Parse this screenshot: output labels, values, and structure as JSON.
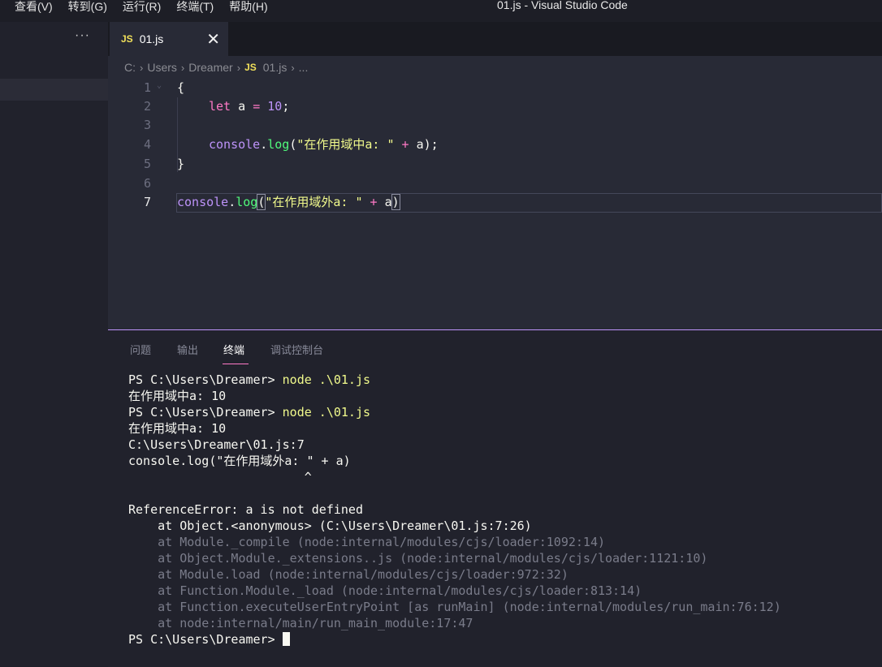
{
  "menu": [
    "查看(V)",
    "转到(G)",
    "运行(R)",
    "终端(T)",
    "帮助(H)"
  ],
  "window_title": "01.js - Visual Studio Code",
  "sidebar": {
    "more_label": "···"
  },
  "tab": {
    "badge": "JS",
    "label": "01.js",
    "close": "✕"
  },
  "breadcrumb": {
    "items": [
      "C:",
      "Users",
      "Dreamer"
    ],
    "file_badge": "JS",
    "file": "01.js",
    "tail": "...",
    "separator": "›"
  },
  "editor": {
    "line_numbers": [
      "1",
      "2",
      "3",
      "4",
      "5",
      "6",
      "7"
    ],
    "active_line": "7",
    "code": {
      "l1": "{",
      "l2_kw": "let",
      "l2_var": " a ",
      "l2_op": "=",
      "l2_num": "10",
      "l2_end": ";",
      "l4_obj": "console",
      "l4_dot": ".",
      "l4_fn": "log",
      "l4_open": "(",
      "l4_str": "\"在作用域中a: \"",
      "l4_op": " + ",
      "l4_rest": "a);",
      "l5": "}",
      "l7_obj": "console",
      "l7_dot": ".",
      "l7_fn": "log",
      "l7_open": "(",
      "l7_str": "\"在作用域外a: \"",
      "l7_op": " + ",
      "l7_var": "a",
      "l7_close": ")"
    }
  },
  "panel": {
    "tabs": [
      "问题",
      "输出",
      "终端",
      "调试控制台"
    ],
    "active_tab": "终端"
  },
  "terminal": {
    "prompt": "PS C:\\Users\\Dreamer> ",
    "command": "node .\\01.js",
    "out1": "在作用域中a: 10",
    "err_loc": "C:\\Users\\Dreamer\\01.js:7",
    "err_src": "console.log(\"在作用域外a: \" + a)",
    "err_caret": "                        ^",
    "err_msg": "ReferenceError: a is not defined",
    "stack": [
      "    at Object.<anonymous> (C:\\Users\\Dreamer\\01.js:7:26)",
      "    at Module._compile (node:internal/modules/cjs/loader:1092:14)",
      "    at Object.Module._extensions..js (node:internal/modules/cjs/loader:1121:10)",
      "    at Module.load (node:internal/modules/cjs/loader:972:32)",
      "    at Function.Module._load (node:internal/modules/cjs/loader:813:14)",
      "    at Function.executeUserEntryPoint [as runMain] (node:internal/modules/run_main:76:12)",
      "    at node:internal/main/run_main_module:17:47"
    ],
    "final_prompt": "PS C:\\Users\\Dreamer> "
  },
  "colors": {
    "accent_panel_border": "#bd93f9",
    "active_tab_underline": "#ff79c6",
    "js_badge": "#f1e05a",
    "editor_bg": "#282a36"
  }
}
